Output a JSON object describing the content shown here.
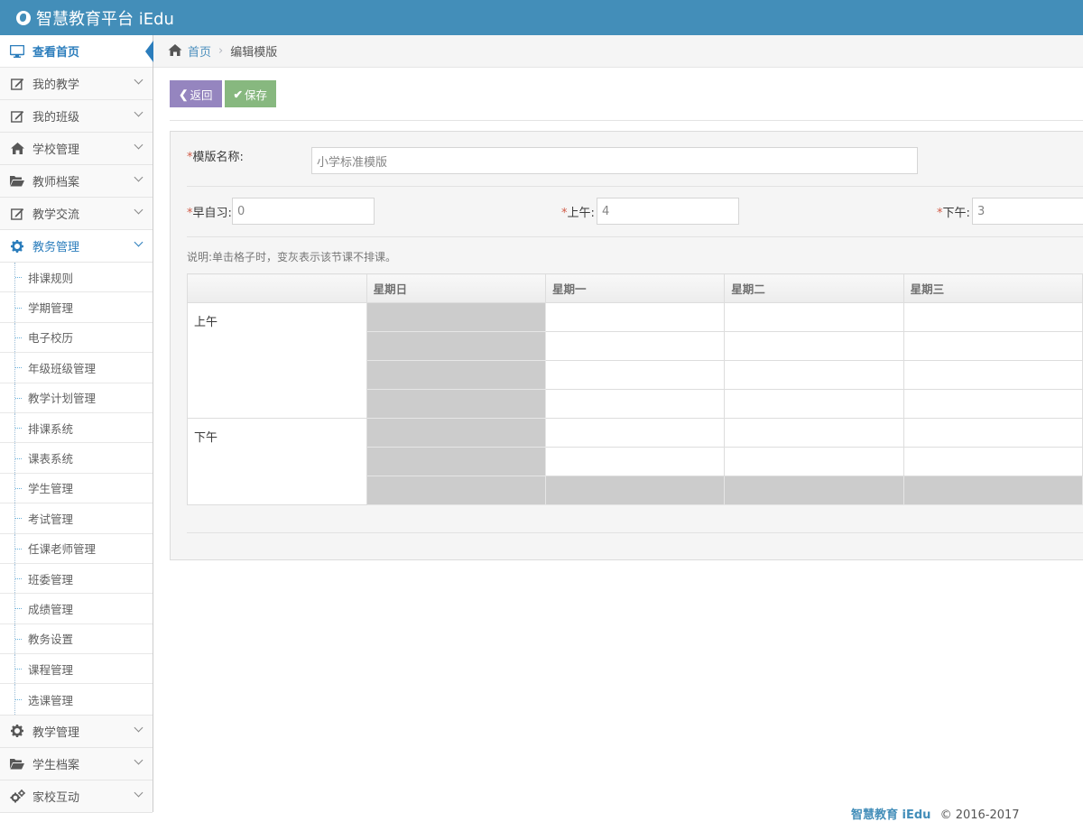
{
  "app": {
    "title": "智慧教育平台 iEdu"
  },
  "sidebar": {
    "items": [
      {
        "label": "查看首页",
        "icon": "desktop-icon"
      },
      {
        "label": "我的教学",
        "icon": "edit-icon"
      },
      {
        "label": "我的班级",
        "icon": "edit-icon"
      },
      {
        "label": "学校管理",
        "icon": "home-icon"
      },
      {
        "label": "教师档案",
        "icon": "folder-open-icon"
      },
      {
        "label": "教学交流",
        "icon": "edit-icon"
      },
      {
        "label": "教务管理",
        "icon": "gear-icon"
      }
    ],
    "submenu": [
      "排课规则",
      "学期管理",
      "电子校历",
      "年级班级管理",
      "教学计划管理",
      "排课系统",
      "课表系统",
      "学生管理",
      "考试管理",
      "任课老师管理",
      "班委管理",
      "成绩管理",
      "教务设置",
      "课程管理",
      "选课管理"
    ],
    "items_after": [
      {
        "label": "教学管理",
        "icon": "gear-icon"
      },
      {
        "label": "学生档案",
        "icon": "folder-open-icon"
      },
      {
        "label": "家校互动",
        "icon": "gears-icon"
      }
    ]
  },
  "breadcrumb": {
    "home": "首页",
    "current": "编辑模版"
  },
  "toolbar": {
    "back_label": "返回",
    "save_label": "保存"
  },
  "form": {
    "required_mark": "*",
    "name_label": "模版名称:",
    "name_placeholder": "小学标准模版",
    "morning_study_label": "早自习:",
    "morning_study_value": "0",
    "am_label": "上午:",
    "am_value": "4",
    "pm_label": "下午:",
    "pm_value": "3",
    "note": "说明:单击格子时，变灰表示该节课不排课。"
  },
  "schedule": {
    "headers": [
      "",
      "星期日",
      "星期一",
      "星期二",
      "星期三"
    ],
    "periods": [
      {
        "label": "上午",
        "rows": 4
      },
      {
        "label": "下午",
        "rows": 3
      }
    ]
  },
  "footer": {
    "brand": "智慧教育 iEdu",
    "copyright": "© 2016-2017"
  }
}
